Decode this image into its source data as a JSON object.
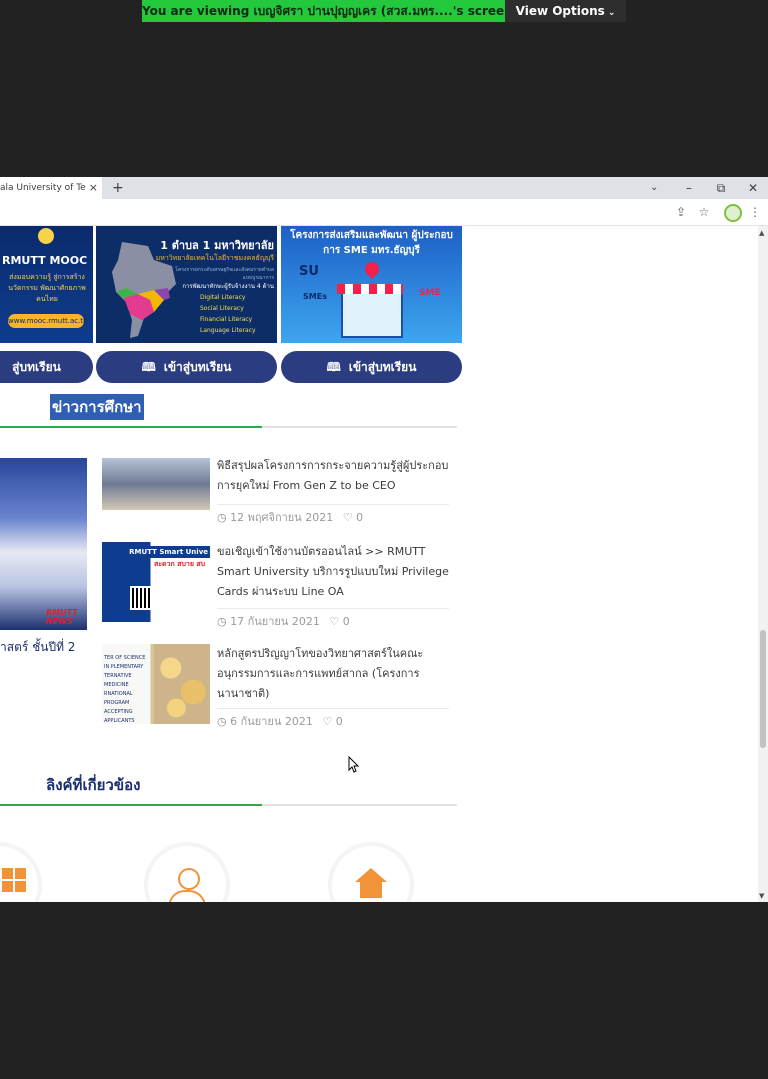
{
  "zoom": {
    "banner_text": "You are viewing เบญจิศรา ปานปุญญเคร (สวส.มทร....'s screen",
    "view_options_label": "View Options",
    "banner_color": "#22c93c"
  },
  "browser": {
    "tab_title": "ala University of Techno",
    "tab_close": "×",
    "new_tab": "+",
    "tab_search": "⌄",
    "minimize": "–",
    "restore": "⧉",
    "close": "✕"
  },
  "banners": {
    "mooc": {
      "title": "RMUTT MOOC",
      "subtitle": "ส่งมอบความรู้ สู่การสร้างนวัตกรรม พัฒนาศักยภาพคนไทย",
      "url": "www.mooc.rmutt.ac.th"
    },
    "one_tambon": {
      "title": "1 ตำบล 1 มหาวิทยาลัย",
      "subtitle": "มหาวิทยาลัยเทคโนโลยีราชมงคลธัญบุรี",
      "line": "โครงการยกระดับเศรษฐกิจและสังคมรายตำบลแบบบูรณาการ",
      "heading": "การพัฒนาทักษะผู้รับจ้างงาน 4 ด้าน",
      "literacies": [
        "Digital Literacy",
        "Social Literacy",
        "Financial Literacy",
        "Language Literacy"
      ]
    },
    "sme": {
      "title": "โครงการส่งเสริมและพัฒนา ผู้ประกอบการ SME มทร.ธัญบุรี",
      "su": "SU",
      "smes": "SMEs",
      "sme_label": "SME"
    }
  },
  "buttons": {
    "enter_lesson_1": "สู่บทเรียน",
    "enter_lesson_2": "เข้าสู่บทเรียน",
    "enter_lesson_3": "เข้าสู่บทเรียน",
    "book_icon": "🕮"
  },
  "sections": {
    "news_title": "ข่าวการศึกษา",
    "links_title": "ลิงค์ที่เกี่ยวข้อง"
  },
  "feature": {
    "caption": "าสตร์ ชั้นปีที่ 2",
    "badge": "RMUTT NEWS"
  },
  "news": [
    {
      "title": "พิธีสรุปผลโครงการการกระจายความรู้สู่ผู้ประกอบการยุคใหม่ From Gen Z to be CEO",
      "date": "12 พฤศจิกายน 2021",
      "likes": "0"
    },
    {
      "title": "ขอเชิญเข้าใช้งานบัตรออนไลน์ >> RMUTT Smart University บริการรูปแบบใหม่ Privilege Cards ผ่านระบบ Line OA",
      "date": "17 กันยายน 2021",
      "likes": "0",
      "thumb_head": "RMUTT Smart Unive",
      "thumb_red": "สะดวก สบาย สบ"
    },
    {
      "title": "หลักสูตรปริญญาโทของวิทยาศาสตร์ในคณะอนุกรรมการและการแพทย์สากล (โครงการนานาชาติ)",
      "date": "6 กันยายน 2021",
      "likes": "0",
      "thumb_text": "TER OF SCIENCE IN PLEMENTARY TERNATIVE MEDICINE RNATIONAL PROGRAM ACCEPTING APPLICANTS"
    }
  ],
  "icons": {
    "clock": "◷",
    "heart": "♡"
  }
}
